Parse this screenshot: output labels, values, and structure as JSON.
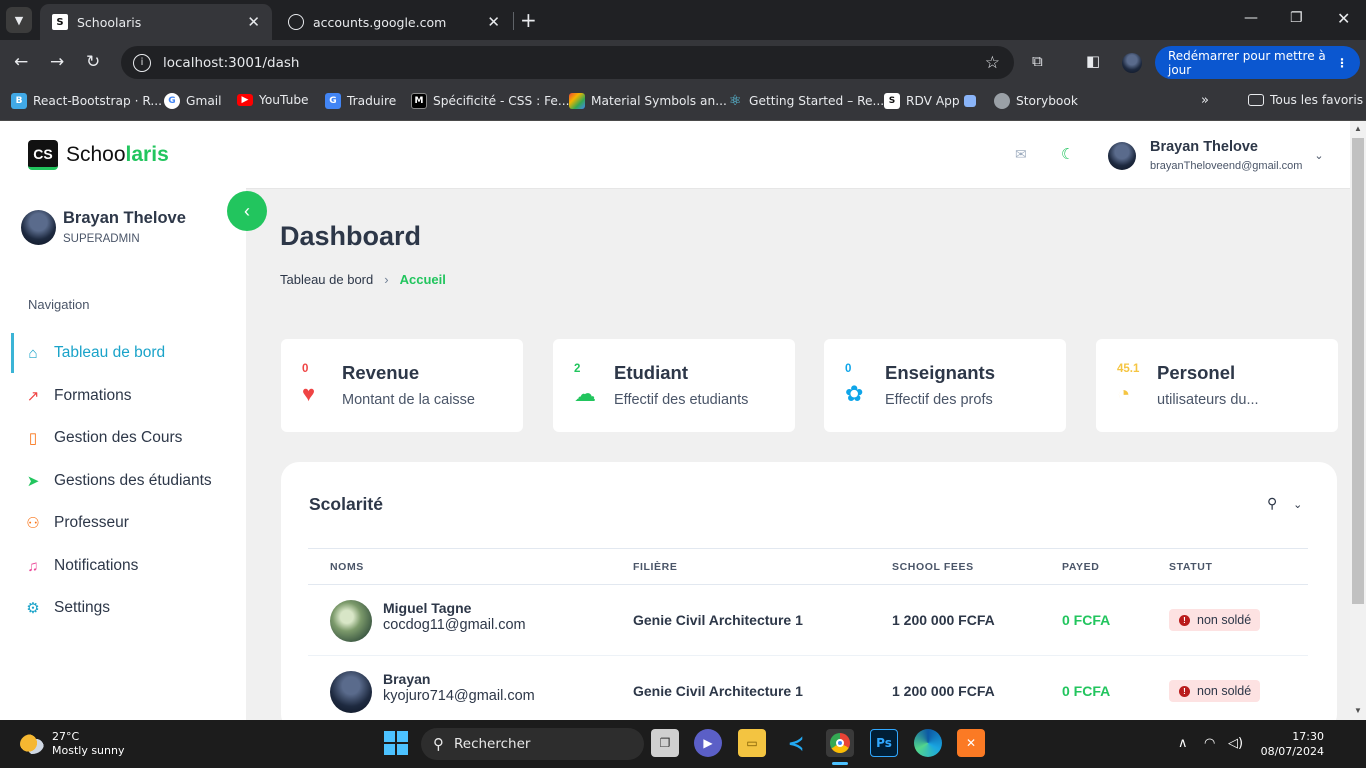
{
  "browser": {
    "tabs": [
      {
        "title": "Schoolaris",
        "active": true
      },
      {
        "title": "accounts.google.com",
        "active": false
      }
    ],
    "url": "localhost:3001/dash",
    "update_button": "Redémarrer pour mettre à jour",
    "bookmarks": [
      {
        "label": "React-Bootstrap · R...",
        "icon": "react-bootstrap-icon",
        "color": "#41a9e6"
      },
      {
        "label": "Gmail",
        "icon": "google-icon",
        "color": "#4285f4"
      },
      {
        "label": "YouTube",
        "icon": "youtube-icon",
        "color": "#ff0000"
      },
      {
        "label": "Traduire",
        "icon": "translate-icon",
        "color": "#4285f4"
      },
      {
        "label": "Spécificité - CSS : Fe...",
        "icon": "mdn-icon",
        "color": "#000000"
      },
      {
        "label": "Material Symbols an...",
        "icon": "material-icon",
        "color": "#f4b400"
      },
      {
        "label": "Getting Started – Re...",
        "icon": "react-icon",
        "color": "#61dafb"
      },
      {
        "label": "RDV App",
        "icon": "rdv-app-icon",
        "color": "#222222"
      },
      {
        "label": "Storybook",
        "icon": "globe-icon",
        "color": "#9aa0a6"
      }
    ],
    "all_bookmarks": "Tous les favoris"
  },
  "app": {
    "logo_prefix": "Schoo",
    "logo_suffix": "laris",
    "logo_mark": "CS",
    "accent": "#22c55e",
    "user": {
      "name": "Brayan Thelove",
      "role": "SUPERADMIN",
      "email": "brayanTheloveend@gmail.com"
    },
    "nav_label": "Navigation",
    "nav": [
      {
        "label": "Tableau de bord",
        "icon": "dashboard-icon",
        "active": true,
        "color": "#1aa3c9"
      },
      {
        "label": "Formations",
        "icon": "trending-up-icon",
        "color": "#ef4444"
      },
      {
        "label": "Gestion des Cours",
        "icon": "book-icon",
        "color": "#f97316"
      },
      {
        "label": "Gestions des étudiants",
        "icon": "send-icon",
        "color": "#22c55e"
      },
      {
        "label": "Professeur",
        "icon": "user-icon",
        "color": "#f97316"
      },
      {
        "label": "Notifications",
        "icon": "bell-icon",
        "color": "#ec4899"
      },
      {
        "label": "Settings",
        "icon": "gear-icon",
        "color": "#1aa3c9"
      }
    ],
    "page_title": "Dashboard",
    "breadcrumb": {
      "root": "Tableau de bord",
      "current": "Accueil"
    },
    "cards": [
      {
        "value": "0",
        "title": "Revenue",
        "subtitle": "Montant de la caisse",
        "icon": "heart-pulse-icon",
        "color": "#ef4444"
      },
      {
        "value": "2",
        "title": "Etudiant",
        "subtitle": "Effectif des etudiants",
        "icon": "cloud-rain-icon",
        "color": "#22c55e"
      },
      {
        "value": "0",
        "title": "Enseignants",
        "subtitle": "Effectif des profs",
        "icon": "paw-icon",
        "color": "#0ea5e9"
      },
      {
        "value": "45.1",
        "title": "Personel",
        "subtitle": "utilisateurs du...",
        "icon": "gauge-icon",
        "color": "#f5c542"
      }
    ],
    "table": {
      "title": "Scolarité",
      "headers": [
        "NOMS",
        "FILIÈRE",
        "SCHOOL FEES",
        "PAYED",
        "STATUT"
      ],
      "rows": [
        {
          "name": "Miguel Tagne",
          "email": "cocdog11@gmail.com",
          "filiere": "Genie Civil Architecture 1",
          "fees": "1 200 000 FCFA",
          "payed": "0 FCFA",
          "status": "non soldé"
        },
        {
          "name": "Brayan",
          "email": "kyojuro714@gmail.com",
          "filiere": "Genie Civil Architecture 1",
          "fees": "1 200 000 FCFA",
          "payed": "0 FCFA",
          "status": "non soldé"
        }
      ]
    }
  },
  "taskbar": {
    "weather_temp": "27°C",
    "weather_desc": "Mostly sunny",
    "search_placeholder": "Rechercher",
    "time": "17:30",
    "date": "08/07/2024"
  }
}
